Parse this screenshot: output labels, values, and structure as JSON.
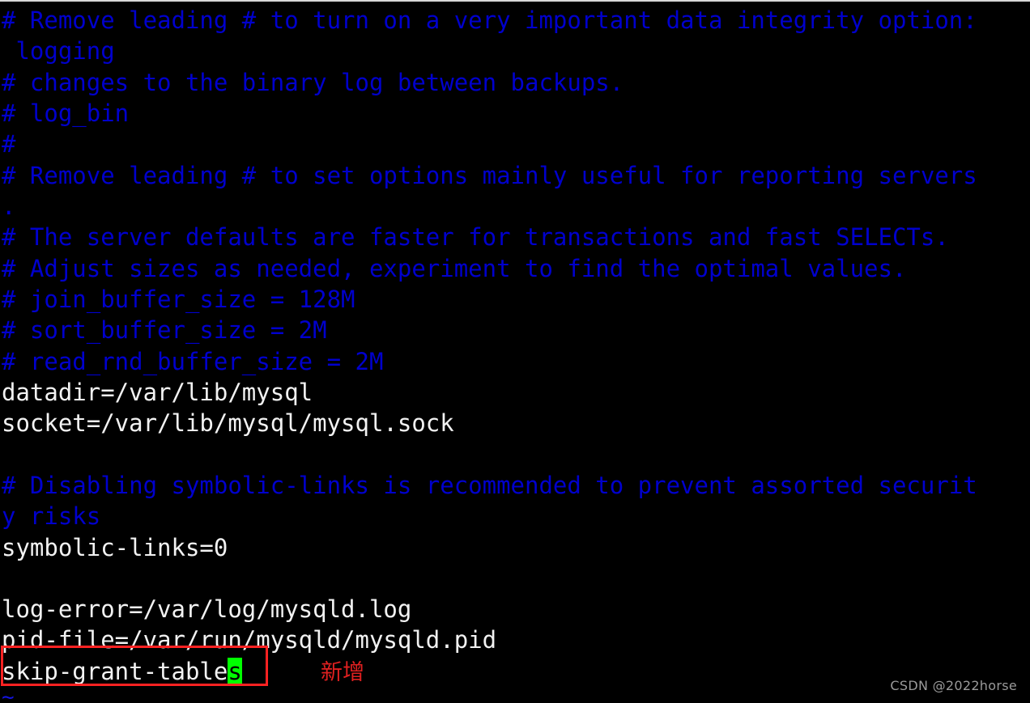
{
  "app": {
    "kind": "terminal",
    "editor": "vim",
    "file": "/etc/my.cnf",
    "background_color": "#000000",
    "comment_color": "#0000cd",
    "text_color": "#f2f2f2",
    "cursor_color": "#00ff00",
    "annotation_color": "#ff2222"
  },
  "buffer": {
    "lines": [
      {
        "text": "# Remove leading # to turn on a very important data integrity option:",
        "style": "comment",
        "wrapped_from": null
      },
      {
        "text": " logging",
        "style": "comment",
        "wrapped_from": 0
      },
      {
        "text": "# changes to the binary log between backups.",
        "style": "comment",
        "wrapped_from": null
      },
      {
        "text": "# log_bin",
        "style": "comment",
        "wrapped_from": null
      },
      {
        "text": "#",
        "style": "comment",
        "wrapped_from": null
      },
      {
        "text": "# Remove leading # to set options mainly useful for reporting servers",
        "style": "comment",
        "wrapped_from": null
      },
      {
        "text": ".",
        "style": "comment",
        "wrapped_from": 5
      },
      {
        "text": "# The server defaults are faster for transactions and fast SELECTs.",
        "style": "comment",
        "wrapped_from": null
      },
      {
        "text": "# Adjust sizes as needed, experiment to find the optimal values.",
        "style": "comment",
        "wrapped_from": null
      },
      {
        "text": "# join_buffer_size = 128M",
        "style": "comment",
        "wrapped_from": null
      },
      {
        "text": "# sort_buffer_size = 2M",
        "style": "comment",
        "wrapped_from": null
      },
      {
        "text": "# read_rnd_buffer_size = 2M",
        "style": "comment",
        "wrapped_from": null
      },
      {
        "text": "datadir=/var/lib/mysql",
        "style": "plain",
        "wrapped_from": null
      },
      {
        "text": "socket=/var/lib/mysql/mysql.sock",
        "style": "plain",
        "wrapped_from": null
      },
      {
        "text": "",
        "style": "plain",
        "wrapped_from": null
      },
      {
        "text": "# Disabling symbolic-links is recommended to prevent assorted securit",
        "style": "comment",
        "wrapped_from": null
      },
      {
        "text": "y risks",
        "style": "comment",
        "wrapped_from": 15
      },
      {
        "text": "symbolic-links=0",
        "style": "plain",
        "wrapped_from": null
      },
      {
        "text": "",
        "style": "plain",
        "wrapped_from": null
      },
      {
        "text": "log-error=/var/log/mysqld.log",
        "style": "plain",
        "wrapped_from": null
      },
      {
        "text": "pid-file=/var/run/mysqld/mysqld.pid",
        "style": "plain",
        "wrapped_from": null
      }
    ],
    "cursor_line": {
      "before_cursor": "skip-grant-table",
      "cursor_char": "s",
      "after_cursor": "",
      "style": "plain"
    },
    "empty_marker": "~"
  },
  "annotation": {
    "label": "新增",
    "box_target": "skip-grant-tables"
  },
  "watermark": {
    "text": "CSDN @2022horse"
  }
}
